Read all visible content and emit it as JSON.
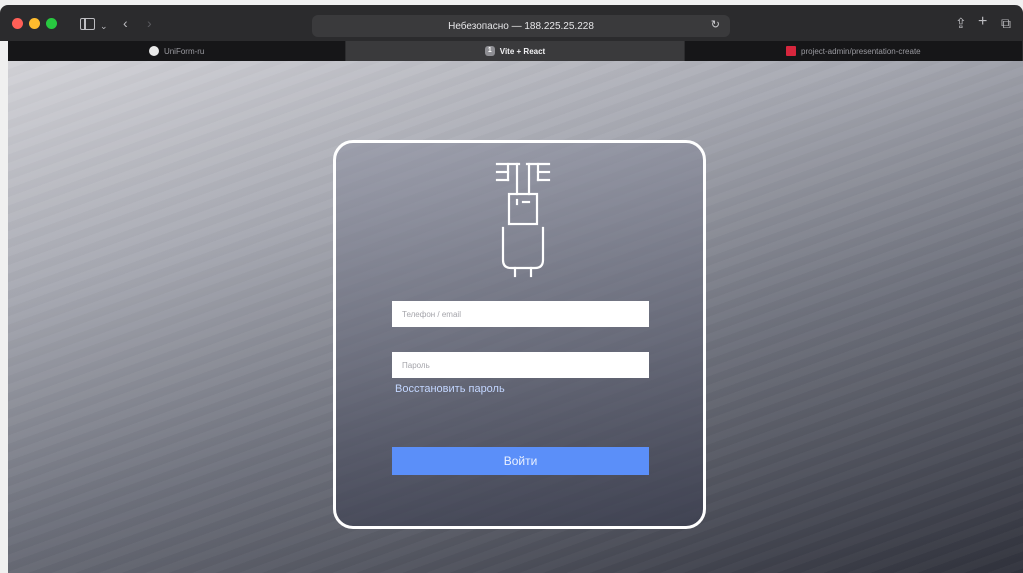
{
  "browser": {
    "address_text": "Небезопасно — 188.225.25.228",
    "tabs": [
      {
        "label": "UniForm-ru",
        "active": false,
        "favicon": "github-icon"
      },
      {
        "label": "Vite + React",
        "active": true,
        "favicon": "number-1-icon"
      },
      {
        "label": "project-admin/presentation-create",
        "active": false,
        "favicon": "red-grid-icon"
      }
    ]
  },
  "login": {
    "phone_placeholder": "Телефон / email",
    "password_placeholder": "Пароль",
    "restore_label": "Восстановить пароль",
    "submit_label": "Войти"
  },
  "colors": {
    "accent": "#5b8ff9",
    "link": "#c3d6ff",
    "card_border": "#ffffff"
  }
}
